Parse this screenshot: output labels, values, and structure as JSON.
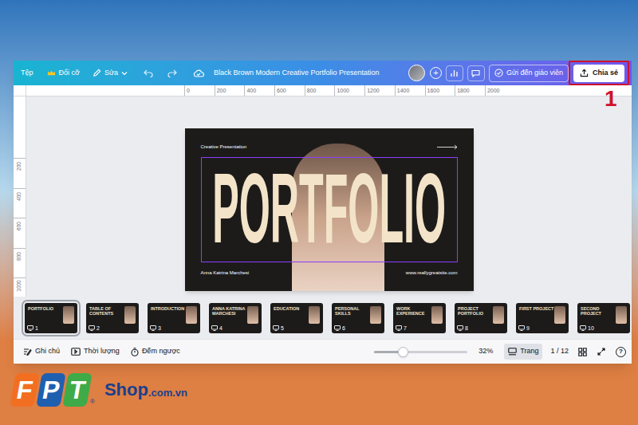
{
  "toolbar": {
    "file": "Tệp",
    "resize": "Đổi cỡ",
    "edit": "Sửa",
    "title": "Black Brown Modern Creative Portfolio Presentation",
    "add": "+",
    "send": "Gửi đến giáo viên",
    "share": "Chia sẻ"
  },
  "annotation": {
    "label": "1"
  },
  "ruler": {
    "horizontal": [
      "0",
      "200",
      "400",
      "600",
      "800",
      "1000",
      "1200",
      "1400",
      "1600",
      "1800",
      "2000"
    ],
    "vertical": [
      "200",
      "400",
      "600",
      "800",
      "1000"
    ]
  },
  "slide": {
    "kicker": "Creative Presentation",
    "title": "PORTFOLIO",
    "title_selected": true,
    "author": "Anna Katrina Marchesi",
    "website": "www.reallygreatsite.com"
  },
  "thumbnails": [
    {
      "number": "1",
      "title": "PORTFOLIO",
      "selected": true
    },
    {
      "number": "2",
      "title": "TABLE OF CONTENTS",
      "selected": false
    },
    {
      "number": "3",
      "title": "INTRODUCTION",
      "selected": false
    },
    {
      "number": "4",
      "title": "ANNA KATRINA MARCHESI",
      "selected": false
    },
    {
      "number": "5",
      "title": "EDUCATION",
      "selected": false
    },
    {
      "number": "6",
      "title": "PERSONAL SKILLS",
      "selected": false
    },
    {
      "number": "7",
      "title": "WORK EXPERIENCE",
      "selected": false
    },
    {
      "number": "8",
      "title": "PROJECT PORTFOLIO",
      "selected": false
    },
    {
      "number": "9",
      "title": "FIRST PROJECT",
      "selected": false
    },
    {
      "number": "10",
      "title": "SECOND PROJECT",
      "selected": false
    }
  ],
  "footer": {
    "notes": "Ghi chú",
    "duration": "Thời lượng",
    "timer": "Đếm ngược",
    "zoom": {
      "level": 0.31,
      "reading": "32%"
    },
    "pages": {
      "label": "Trang",
      "selected": true
    },
    "page_count": "1 / 12",
    "help": "?"
  },
  "watermark": {
    "letters": [
      {
        "text": "F",
        "color": "#f26f21"
      },
      {
        "text": "P",
        "color": "#1f5fb0"
      },
      {
        "text": "T",
        "color": "#3faa48"
      }
    ],
    "registered": "®",
    "shop": "Shop",
    "domain": ".com.vn"
  }
}
